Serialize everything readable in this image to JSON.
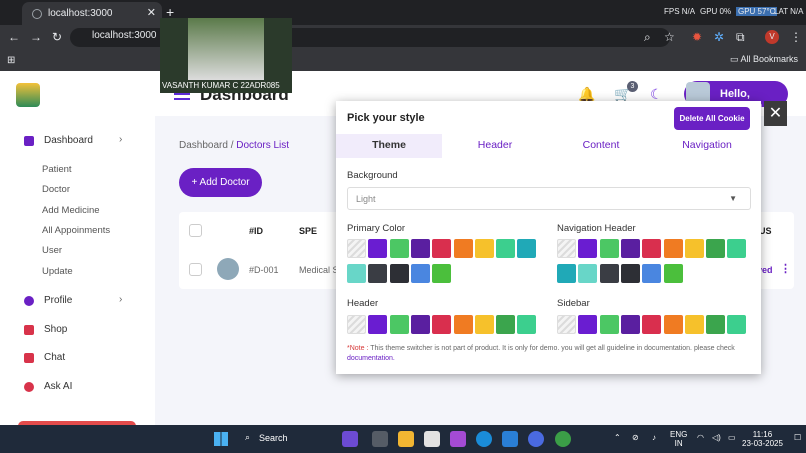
{
  "browser": {
    "tab_title": "localhost:3000",
    "address": "localhost:3000",
    "bookmarks_label": "All Bookmarks",
    "sys_fps": "FPS N/A",
    "sys_gpu": "GPU 0%",
    "sys_gpu2": "GPU 57°C",
    "sys_lat": "LAT N/A",
    "profile_initial": "V"
  },
  "webcam": {
    "caption": "VASANTH KUMAR C 22ADR085"
  },
  "app": {
    "brand": "Dashboard",
    "notif_count": "3",
    "greeting": "Hello, Vasanth"
  },
  "sidebar": {
    "items": [
      {
        "label": "Dashboard"
      },
      {
        "label": "Profile"
      },
      {
        "label": "Shop"
      },
      {
        "label": "Chat"
      },
      {
        "label": "Ask AI"
      }
    ],
    "subitems": [
      "Patient",
      "Doctor",
      "Add Medicine",
      "All Appoinments",
      "User",
      "Update"
    ]
  },
  "content": {
    "breadcrumb_root": "Dashboard",
    "breadcrumb_sep": "/",
    "breadcrumb_current": "Doctors List",
    "add_button": "+ Add Doctor",
    "columns": [
      "#ID",
      "SPE",
      "US"
    ],
    "row": {
      "id": "#D-001",
      "spec": "Medical Su",
      "status": "ved"
    }
  },
  "modal": {
    "title": "Pick your style",
    "delete_button": "Delete All Cookie",
    "tabs": [
      "Theme",
      "Header",
      "Content",
      "Navigation"
    ],
    "active_tab": "Theme",
    "background_label": "Background",
    "background_value": "Light",
    "primary_label": "Primary Color",
    "nav_header_label": "Navigation Header",
    "header_label": "Header",
    "sidebar_label": "Sidebar",
    "note_prefix": "*Note :",
    "note_text": "This theme switcher is not part of product. It is only for demo. you will get all guideline in documentation. please check",
    "note_link": "documentation.",
    "primary_colors": [
      "none",
      "#6a1dd1",
      "#4cc764",
      "#5a1fa0",
      "#d92f4e",
      "#f07b22",
      "#f6c12b",
      "#3ccf8e",
      "#20a9b7",
      "#68d6c8",
      "#3a3d44",
      "#2d2f35",
      "#4a86e0",
      "#4bbf3c"
    ],
    "nav_header_colors": [
      "none",
      "#6a1dd1",
      "#4cc764",
      "#5a1fa0",
      "#d92f4e",
      "#f07b22",
      "#f6c12b",
      "#3ba54d",
      "#3ccf8e",
      "#20a9b7",
      "#68d6c8",
      "#3a3d44",
      "#2d2f35",
      "#4a86e0",
      "#4bbf3c"
    ],
    "header_colors": [
      "none",
      "#6a1dd1",
      "#4cc764",
      "#5a1fa0",
      "#d92f4e",
      "#f07b22",
      "#f6c12b",
      "#3ba54d",
      "#3ccf8e"
    ],
    "sidebar_colors": [
      "none",
      "#6a1dd1",
      "#4cc764",
      "#5a1fa0",
      "#d92f4e",
      "#f07b22",
      "#f6c12b",
      "#3ba54d",
      "#3ccf8e"
    ]
  },
  "taskbar": {
    "search": "Search",
    "lang1": "ENG",
    "lang2": "IN",
    "time": "11:16",
    "date": "23-03-2025"
  }
}
